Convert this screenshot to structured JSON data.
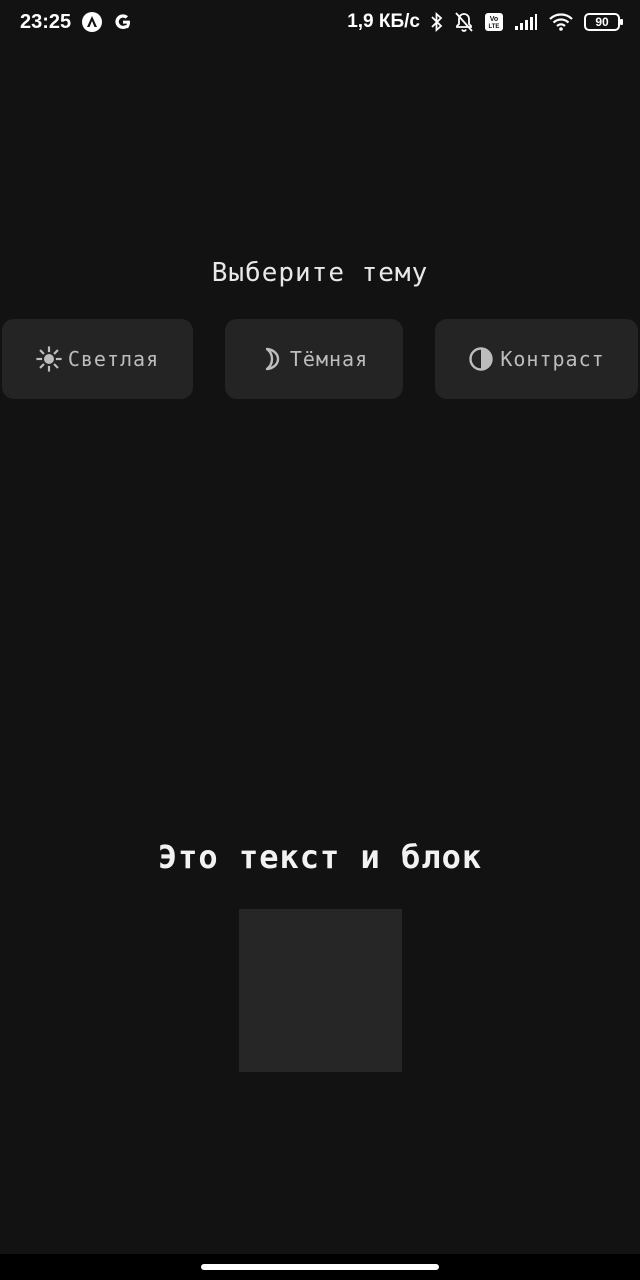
{
  "status_bar": {
    "time": "23:25",
    "left_icons": [
      "app-a-icon",
      "google-g-icon"
    ],
    "network_speed": "1,9 КБ/с",
    "right_icons": [
      "bluetooth-icon",
      "notifications-off-icon",
      "volte-icon",
      "signal-icon",
      "wifi-icon"
    ],
    "battery_level": "90"
  },
  "main": {
    "title": "Выберите тему",
    "themes": [
      {
        "label": "Светлая",
        "icon": "sun-icon"
      },
      {
        "label": "Тёмная",
        "icon": "moon-icon"
      },
      {
        "label": "Контраст",
        "icon": "contrast-icon"
      }
    ],
    "demo_text": "Это текст и блок"
  },
  "colors": {
    "background": "#121212",
    "button_background": "#242424",
    "button_text": "#bdbdbd",
    "demo_block": "#262626",
    "text": "#e8e8e8"
  }
}
